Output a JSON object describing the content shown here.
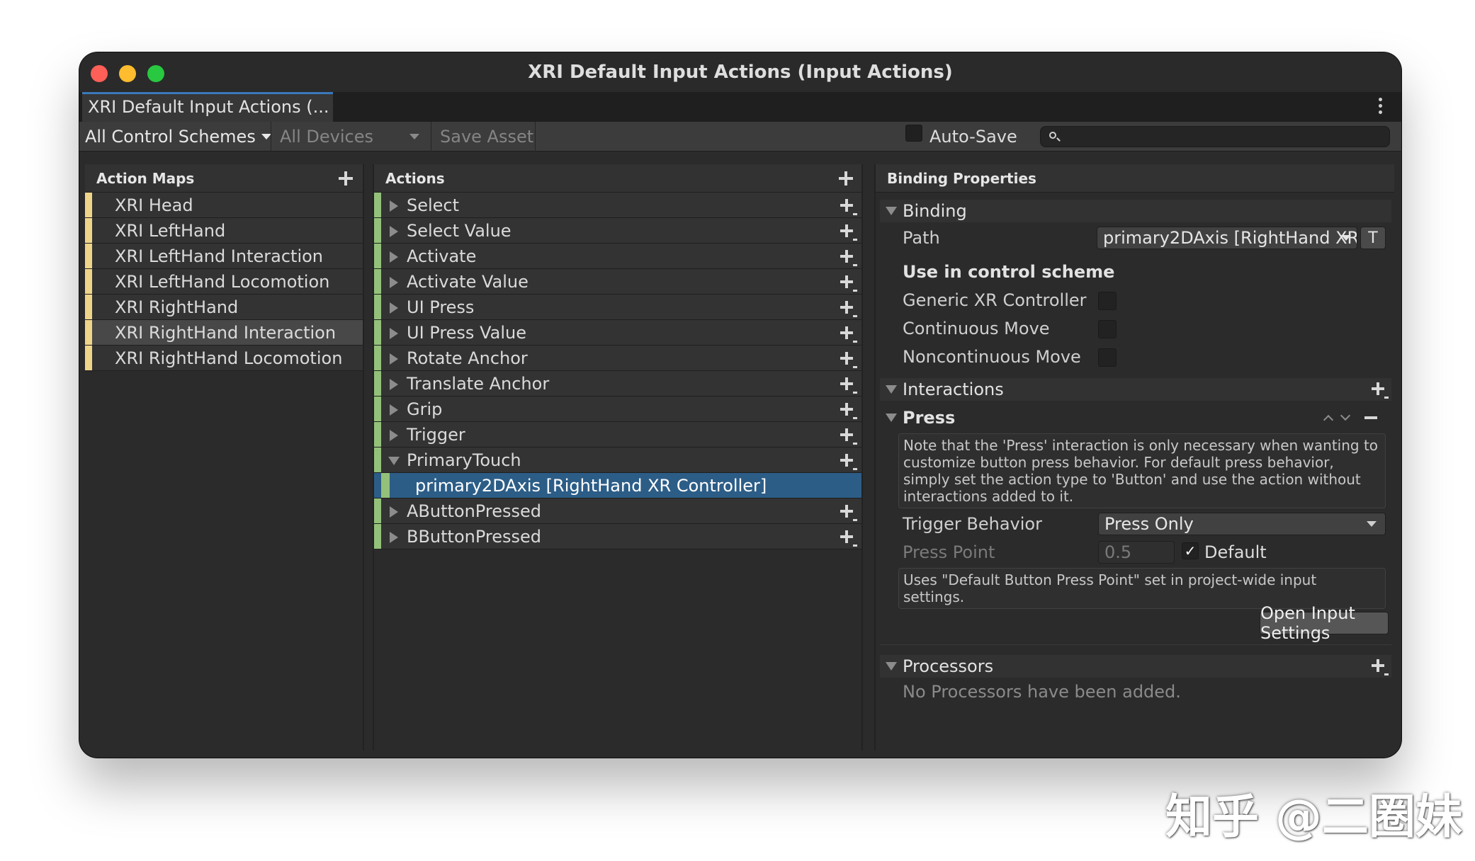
{
  "window": {
    "title": "XRI Default Input Actions (Input Actions)"
  },
  "tab": {
    "label": "XRI Default Input Actions (..."
  },
  "toolbar": {
    "control_schemes": "All Control Schemes",
    "devices": "All Devices",
    "save_asset": "Save Asset",
    "auto_save": "Auto-Save",
    "search_placeholder": ""
  },
  "action_maps": {
    "header": "Action Maps",
    "items": [
      {
        "label": "XRI Head"
      },
      {
        "label": "XRI LeftHand"
      },
      {
        "label": "XRI LeftHand Interaction"
      },
      {
        "label": "XRI LeftHand Locomotion"
      },
      {
        "label": "XRI RightHand"
      },
      {
        "label": "XRI RightHand Interaction",
        "selected": true
      },
      {
        "label": "XRI RightHand Locomotion"
      }
    ]
  },
  "actions": {
    "header": "Actions",
    "items": [
      {
        "label": "Select"
      },
      {
        "label": "Select Value"
      },
      {
        "label": "Activate"
      },
      {
        "label": "Activate Value"
      },
      {
        "label": "UI Press"
      },
      {
        "label": "UI Press Value"
      },
      {
        "label": "Rotate Anchor"
      },
      {
        "label": "Translate Anchor"
      },
      {
        "label": "Grip"
      },
      {
        "label": "Trigger"
      },
      {
        "label": "PrimaryTouch",
        "expanded": true
      },
      {
        "label": "primary2DAxis [RightHand XR Controller]",
        "binding": true,
        "selected": true
      },
      {
        "label": "AButtonPressed"
      },
      {
        "label": "BButtonPressed"
      }
    ]
  },
  "properties": {
    "header": "Binding Properties",
    "binding_section": "Binding",
    "path_label": "Path",
    "path_value": "primary2DAxis [RightHand XR",
    "t_button": "T",
    "control_scheme_heading": "Use in control scheme",
    "schemes": [
      {
        "label": "Generic XR Controller",
        "checked": false
      },
      {
        "label": "Continuous Move",
        "checked": false
      },
      {
        "label": "Noncontinuous Move",
        "checked": false
      }
    ],
    "interactions_section": "Interactions",
    "press_section": "Press",
    "press_note": "Note that the 'Press' interaction is only necessary when wanting to customize button press behavior. For default press behavior, simply set the action type to 'Button' and use the action without interactions added to it.",
    "trigger_behavior_label": "Trigger Behavior",
    "trigger_behavior_value": "Press Only",
    "press_point_label": "Press Point",
    "press_point_value": "0.5",
    "default_label": "Default",
    "default_checked": true,
    "uses_note": "Uses \"Default Button Press Point\" set in project-wide input settings.",
    "open_input_settings": "Open Input Settings",
    "processors_section": "Processors",
    "no_processors": "No Processors have been added."
  },
  "watermark": "知乎 @二圈妹",
  "colors": {
    "map_strip": "#efd58a",
    "action_strip": "#93c17a",
    "selection": "#2c5d87",
    "tab_accent": "#3a79bb"
  }
}
